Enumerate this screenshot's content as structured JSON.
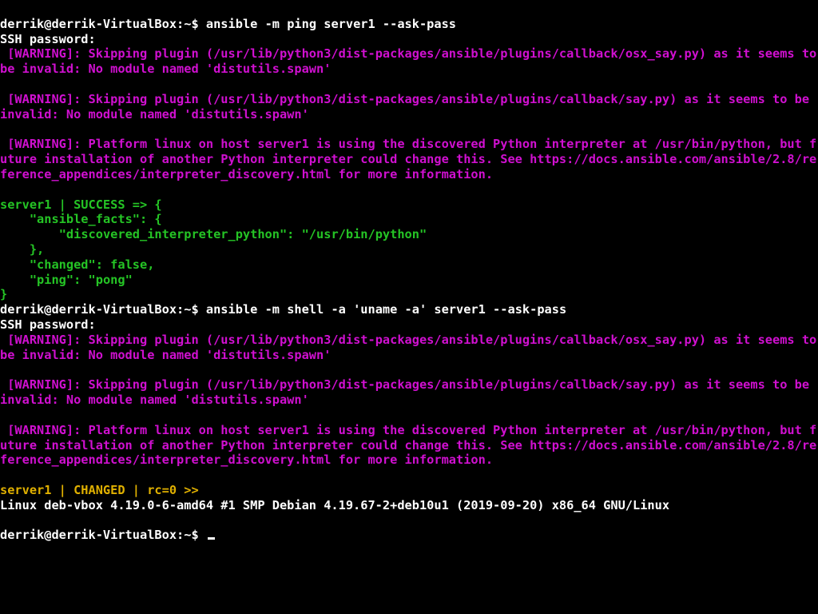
{
  "prompt1": {
    "user": "derrik@derrik-VirtualBox",
    "path": "~",
    "cmd": "ansible -m ping server1 --ask-pass"
  },
  "sshpw": "SSH password:",
  "warn_osx": " [WARNING]: Skipping plugin (/usr/lib/python3/dist-packages/ansible/plugins/callback/osx_say.py) as it seems to be invalid: No module named 'distutils.spawn'",
  "warn_say": " [WARNING]: Skipping plugin (/usr/lib/python3/dist-packages/ansible/plugins/callback/say.py) as it seems to be invalid: No module named 'distutils.spawn'",
  "warn_py": " [WARNING]: Platform linux on host server1 is using the discovered Python interpreter at /usr/bin/python, but future installation of another Python interpreter could change this. See https://docs.ansible.com/ansible/2.8/reference_appendices/interpreter_discovery.html for more information.",
  "success": {
    "l1": "server1 | SUCCESS => {",
    "l2": "    \"ansible_facts\": {",
    "l3": "        \"discovered_interpreter_python\": \"/usr/bin/python\"",
    "l4": "    },",
    "l5": "    \"changed\": false,",
    "l6": "    \"ping\": \"pong\"",
    "l7": "}"
  },
  "prompt2": {
    "user": "derrik@derrik-VirtualBox",
    "path": "~",
    "cmd": "ansible -m shell -a 'uname -a' server1 --ask-pass"
  },
  "result2": {
    "head": "server1 | CHANGED | rc=0 >>",
    "uname": "Linux deb-vbox 4.19.0-6-amd64 #1 SMP Debian 4.19.67-2+deb10u1 (2019-09-20) x86_64 GNU/Linux"
  },
  "prompt3": {
    "user": "derrik@derrik-VirtualBox",
    "path": "~"
  }
}
